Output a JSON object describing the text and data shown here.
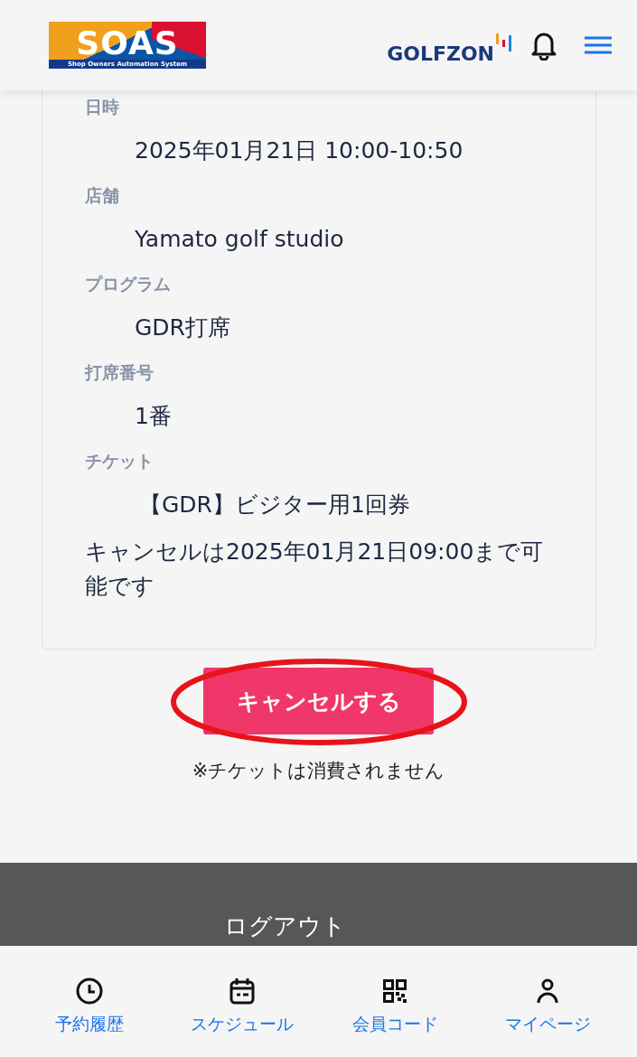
{
  "header": {
    "logo_title": "SOAS",
    "logo_subtitle": "Shop Owners Automation System",
    "brand": "GOLFZON"
  },
  "details": [
    {
      "label": "日時",
      "value": "2025年01月21日 10:00-10:50"
    },
    {
      "label": "店舗",
      "value": "Yamato golf studio"
    },
    {
      "label": "プログラム",
      "value": "GDR打席"
    },
    {
      "label": "打席番号",
      "value": "1番"
    },
    {
      "label": "チケット",
      "value": "【GDR】ビジター用1回券"
    }
  ],
  "cancel_notice": "キャンセルは2025年01月21日09:00まで可能です",
  "cancel_button": "キャンセルする",
  "note": "※チケットは消費されません",
  "logout": "ログアウト",
  "bottom_nav": [
    {
      "kind": "clock",
      "label": "予約履歴"
    },
    {
      "kind": "calendar",
      "label": "スケジュール"
    },
    {
      "kind": "qr",
      "label": "会員コード"
    },
    {
      "kind": "person",
      "label": "マイページ"
    }
  ]
}
